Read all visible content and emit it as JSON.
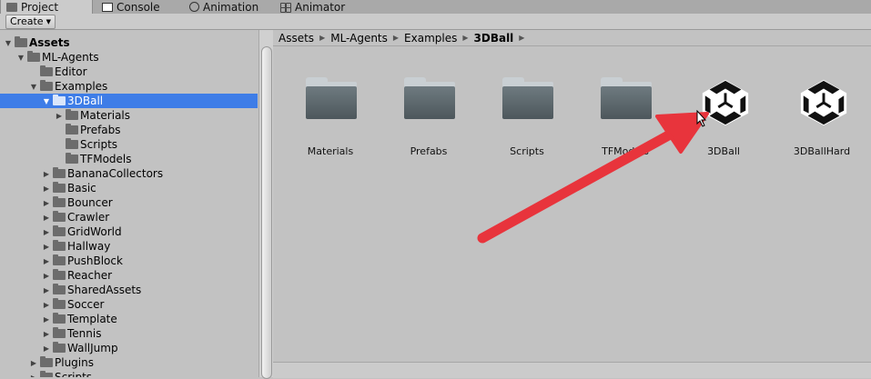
{
  "tabs": [
    {
      "label": "Project",
      "icon": "folder-icon",
      "active": true
    },
    {
      "label": "Console",
      "icon": "console-icon",
      "active": false
    },
    {
      "label": "Animation",
      "icon": "animation-icon",
      "active": false
    },
    {
      "label": "Animator",
      "icon": "animator-icon",
      "active": false
    }
  ],
  "toolbar": {
    "create_label": "Create"
  },
  "tree": [
    {
      "label": "Assets",
      "indent": 0,
      "expanded": true,
      "bold": true
    },
    {
      "label": "ML-Agents",
      "indent": 1,
      "expanded": true
    },
    {
      "label": "Editor",
      "indent": 2,
      "leaf": true
    },
    {
      "label": "Examples",
      "indent": 2,
      "expanded": true
    },
    {
      "label": "3DBall",
      "indent": 3,
      "expanded": true,
      "selected": true
    },
    {
      "label": "Materials",
      "indent": 4,
      "expanded": false
    },
    {
      "label": "Prefabs",
      "indent": 4,
      "leaf": true
    },
    {
      "label": "Scripts",
      "indent": 4,
      "leaf": true
    },
    {
      "label": "TFModels",
      "indent": 4,
      "leaf": true
    },
    {
      "label": "BananaCollectors",
      "indent": 3,
      "expanded": false
    },
    {
      "label": "Basic",
      "indent": 3,
      "expanded": false
    },
    {
      "label": "Bouncer",
      "indent": 3,
      "expanded": false
    },
    {
      "label": "Crawler",
      "indent": 3,
      "expanded": false
    },
    {
      "label": "GridWorld",
      "indent": 3,
      "expanded": false
    },
    {
      "label": "Hallway",
      "indent": 3,
      "expanded": false
    },
    {
      "label": "PushBlock",
      "indent": 3,
      "expanded": false
    },
    {
      "label": "Reacher",
      "indent": 3,
      "expanded": false
    },
    {
      "label": "SharedAssets",
      "indent": 3,
      "expanded": false
    },
    {
      "label": "Soccer",
      "indent": 3,
      "expanded": false
    },
    {
      "label": "Template",
      "indent": 3,
      "expanded": false
    },
    {
      "label": "Tennis",
      "indent": 3,
      "expanded": false
    },
    {
      "label": "WallJump",
      "indent": 3,
      "expanded": false
    },
    {
      "label": "Plugins",
      "indent": 2,
      "expanded": false
    },
    {
      "label": "Scripts",
      "indent": 2,
      "expanded": false
    }
  ],
  "breadcrumb": [
    "Assets",
    "ML-Agents",
    "Examples",
    "3DBall"
  ],
  "assets": [
    {
      "label": "Materials",
      "type": "folder"
    },
    {
      "label": "Prefabs",
      "type": "folder"
    },
    {
      "label": "Scripts",
      "type": "folder"
    },
    {
      "label": "TFModels",
      "type": "folder"
    },
    {
      "label": "3DBall",
      "type": "unity-scene"
    },
    {
      "label": "3DBallHard",
      "type": "unity-scene"
    }
  ],
  "colors": {
    "selection": "#3e7de7",
    "arrow": "#e8343c",
    "panel": "#c2c2c2"
  }
}
